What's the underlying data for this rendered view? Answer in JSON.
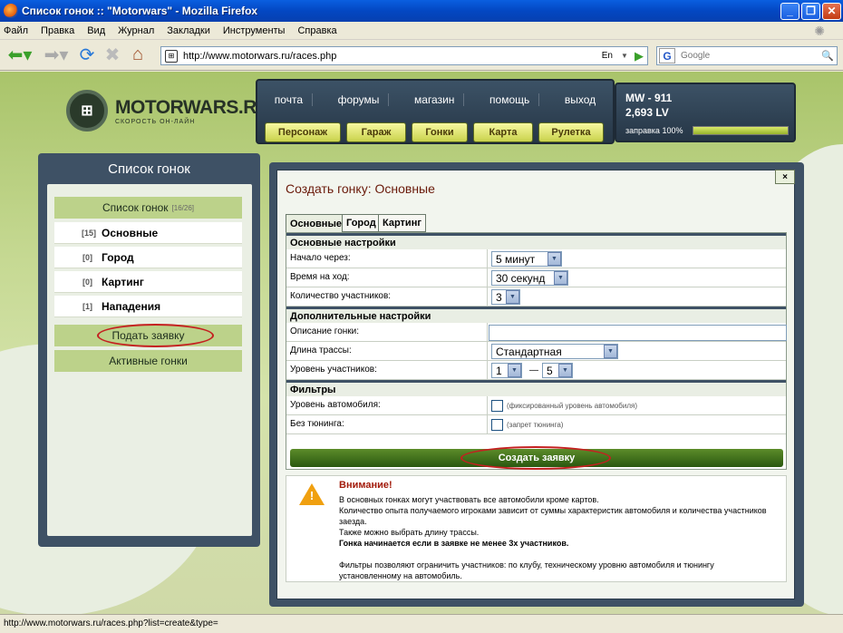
{
  "window": {
    "title": "Список гонок :: \"Motorwars\" - Mozilla Firefox"
  },
  "menu": [
    "Файл",
    "Правка",
    "Вид",
    "Журнал",
    "Закладки",
    "Инструменты",
    "Справка"
  ],
  "address": {
    "url": "http://www.motorwars.ru/races.php",
    "lang": "En"
  },
  "search": {
    "placeholder": "Google",
    "engine": "G"
  },
  "site": {
    "brand": "MOTORWARS.RU",
    "slogan": "СКОРОСТЬ ОН-ЛАЙН",
    "top_links": [
      "почта",
      "форумы",
      "магазин",
      "помощь",
      "выход"
    ],
    "top_buttons": [
      "Персонаж",
      "Гараж",
      "Гонки",
      "Карта",
      "Рулетка"
    ],
    "player": {
      "id": "MW - 911",
      "money": "2,693 LV",
      "fuel_label": "заправка 100%",
      "fuel_fraction": 1.0
    }
  },
  "sidebar": {
    "title": "Список гонок",
    "header_item": {
      "label": "Список гонок",
      "count": "[16/26]"
    },
    "items": [
      {
        "count": "[15]",
        "label": "Основные"
      },
      {
        "count": "[0]",
        "label": "Город"
      },
      {
        "count": "[0]",
        "label": "Картинг"
      },
      {
        "count": "[1]",
        "label": "Нападения"
      }
    ],
    "submit": "Подать заявку",
    "active": "Активные гонки"
  },
  "modal": {
    "close": "×",
    "title": "Создать гонку: Основные",
    "tabs": [
      "Основные",
      "Город",
      "Картинг"
    ],
    "sections": {
      "main": "Основные настройки",
      "extra": "Дополнительные настройки",
      "filters": "Фильтры"
    },
    "fields": {
      "start": {
        "label": "Начало через:",
        "value": "5 минут"
      },
      "turn": {
        "label": "Время на ход:",
        "value": "30 секунд"
      },
      "players": {
        "label": "Количество участников:",
        "value": "3"
      },
      "desc": {
        "label": "Описание гонки:",
        "value": ""
      },
      "length": {
        "label": "Длина трассы:",
        "value": "Стандартная"
      },
      "level": {
        "label": "Уровень участников:",
        "from": "1",
        "sep": "—",
        "to": "5"
      },
      "carlevel": {
        "label": "Уровень автомобиля:",
        "hint": "(фиксированный уровень автомобиля)"
      },
      "tuning": {
        "label": "Без тюнинга:",
        "hint": "(запрет тюнинга)"
      }
    },
    "create": "Создать заявку",
    "warning": {
      "title": "Внимание!",
      "l1": "В основных гонках могут участвовать все автомобили кроме картов.",
      "l2": "Количество опыта получаемого игроками зависит от суммы характеристик автомобиля и количества участников заезда.",
      "l3": "Также можно выбрать длину трассы.",
      "l4": "Гонка начинается если в заявке не менее 3х участников.",
      "l5": "Фильтры позволяют ограничить участников: по клубу, техническому уровню автомобиля и тюнингу установленному на автомобиль."
    }
  },
  "status": {
    "text": "http://www.motorwars.ru/races.php?list=create&type="
  }
}
